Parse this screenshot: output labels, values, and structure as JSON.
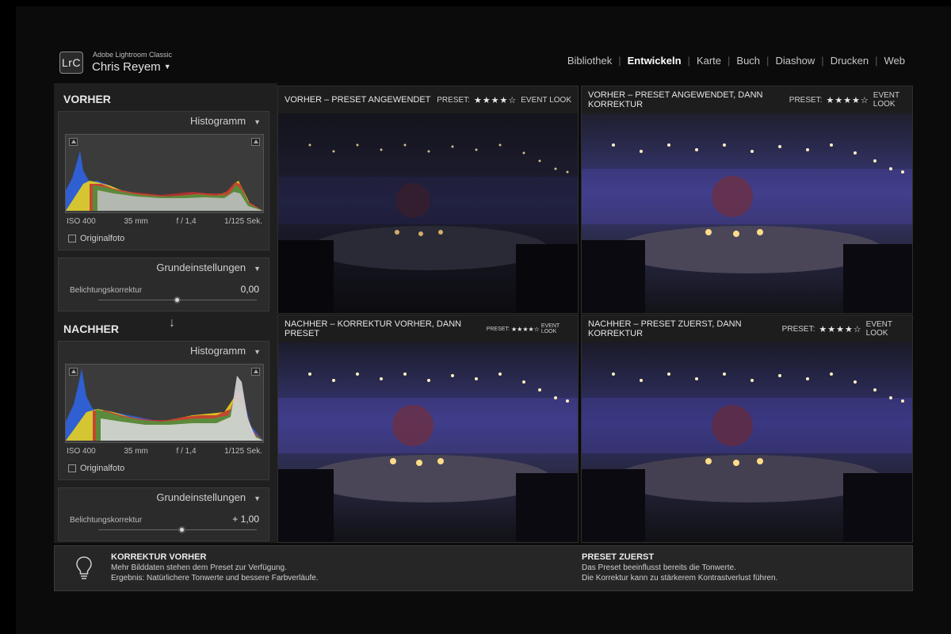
{
  "header": {
    "logo": "LrC",
    "app_name": "Adobe Lightroom Classic",
    "user_name": "Chris Reyem",
    "modules": [
      "Bibliothek",
      "Entwickeln",
      "Karte",
      "Buch",
      "Diashow",
      "Drucken",
      "Web"
    ],
    "active_module": "Entwickeln"
  },
  "left_panel": {
    "before": {
      "title": "VORHER",
      "histogram_label": "Histogramm",
      "exif": {
        "iso": "ISO 400",
        "focal": "35 mm",
        "aperture": "f / 1,4",
        "shutter": "1/125 Sek."
      },
      "original_photo": "Originalfoto",
      "basic_label": "Grundeinstellungen",
      "exposure_label": "Belichtungskorrektur",
      "exposure_value": "0,00",
      "exposure_level": 0.5
    },
    "after": {
      "title": "NACHHER",
      "histogram_label": "Histogramm",
      "exif": {
        "iso": "ISO 400",
        "focal": "35 mm",
        "aperture": "f / 1,4",
        "shutter": "1/125 Sek."
      },
      "original_photo": "Originalfoto",
      "basic_label": "Grundeinstellungen",
      "exposure_label": "Belichtungskorrektur",
      "exposure_value": "+ 1,00",
      "exposure_level": 0.53
    }
  },
  "panels": [
    {
      "title": "VORHER – PRESET ANGEWENDET",
      "preset_label": "PRESET:",
      "stars": "★★★★☆",
      "preset_name": "EVENT LOOK"
    },
    {
      "title": "VORHER – PRESET ANGEWENDET, DANN KORREKTUR",
      "preset_label": "PRESET:",
      "stars": "★★★★☆",
      "preset_name": "EVENT LOOK"
    },
    {
      "title": "NACHHER – KORREKTUR VORHER, DANN PRESET",
      "preset_label": "PRESET:",
      "stars": "★★★★☆",
      "preset_name": "EVENT LOOK"
    },
    {
      "title": "NACHHER – PRESET ZUERST, DANN KORREKTUR",
      "preset_label": "PRESET:",
      "stars": "★★★★☆",
      "preset_name": "EVENT LOOK"
    }
  ],
  "tips": {
    "left": {
      "heading": "KORREKTUR VORHER",
      "line1": "Mehr Bilddaten stehen dem Preset zur Verfügung.",
      "line2": "Ergebnis: Natürlichere Tonwerte und bessere Farbverläufe."
    },
    "right": {
      "heading": "PRESET ZUERST",
      "line1": "Das Preset beeinflusst bereits die Tonwerte.",
      "line2": "Die Korrektur kann zu stärkerem Kontrastverlust führen."
    }
  },
  "icons": {
    "tip": "lightbulb-icon",
    "arrow": "arrow-down-icon",
    "collapse": "triangle-down-icon",
    "clipping": "clipping-indicator-icon"
  }
}
